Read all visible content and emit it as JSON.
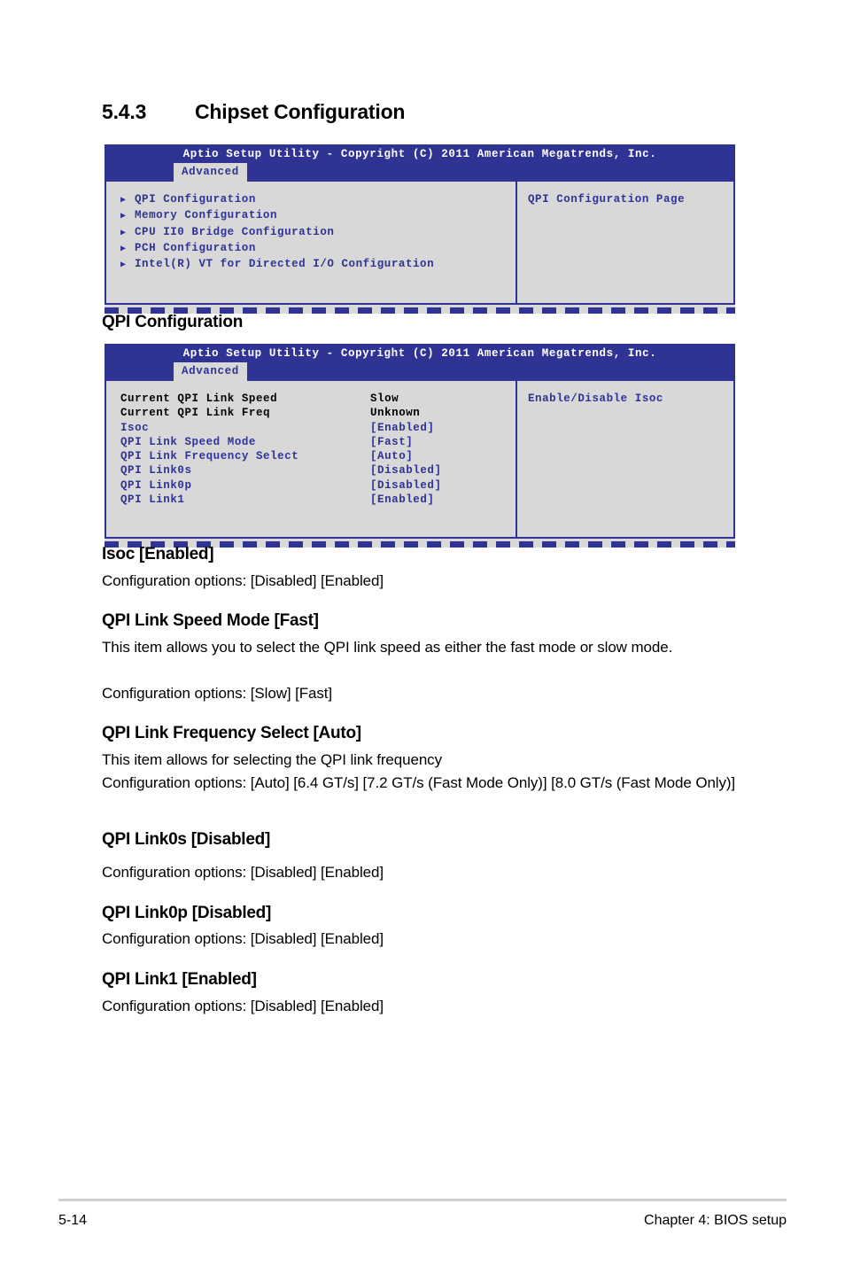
{
  "document": {
    "section_number": "5.4.3",
    "section_title": "Chipset Configuration",
    "subsection_title": "QPI Configuration"
  },
  "bios_screen_chipset": {
    "title": "Aptio Setup Utility - Copyright (C) 2011 American Megatrends, Inc.",
    "tab": "Advanced",
    "menu_items": [
      "QPI Configuration",
      "Memory Configuration",
      "CPU II0 Bridge Configuration",
      "PCH Configuration",
      "Intel(R) VT for Directed I/O Configuration"
    ],
    "help_text": "QPI Configuration Page",
    "arrow_glyph": "▶"
  },
  "bios_screen_qpi": {
    "title": "Aptio Setup Utility - Copyright (C) 2011 American Megatrends, Inc.",
    "tab": "Advanced",
    "help_text": "Enable/Disable Isoc",
    "rows": [
      {
        "label": "Current QPI Link Speed",
        "value": "Slow",
        "editable": false
      },
      {
        "label": "Current QPI Link Freq",
        "value": "Unknown",
        "editable": false
      },
      {
        "label": "Isoc",
        "value": "[Enabled]",
        "editable": true
      },
      {
        "label": "QPI Link Speed Mode",
        "value": "[Fast]",
        "editable": true
      },
      {
        "label": "QPI Link Frequency Select",
        "value": "[Auto]",
        "editable": true
      },
      {
        "label": "QPI Link0s",
        "value": "[Disabled]",
        "editable": true
      },
      {
        "label": "QPI Link0p",
        "value": "[Disabled]",
        "editable": true
      },
      {
        "label": "QPI Link1",
        "value": "[Enabled]",
        "editable": true
      }
    ]
  },
  "items": [
    {
      "title": "Isoc [Enabled]",
      "lines": [
        "Configuration options: [Disabled] [Enabled]"
      ]
    },
    {
      "title": "QPI Link Speed Mode [Fast]",
      "lines": [
        "This item allows you to select the QPI link speed as either the fast mode or slow mode.",
        "Configuration options: [Slow] [Fast]"
      ]
    },
    {
      "title": "QPI Link Frequency Select [Auto]",
      "lines": [
        "This item allows for selecting the QPI link frequency",
        "Configuration options: [Auto] [6.4 GT/s] [7.2 GT/s (Fast Mode Only)] [8.0 GT/s (Fast Mode Only)]"
      ]
    },
    {
      "title": "QPI Link0s [Disabled]",
      "lines": [
        "Configuration options: [Disabled] [Enabled]"
      ]
    },
    {
      "title": "QPI Link0p [Disabled]",
      "lines": [
        "Configuration options: [Disabled] [Enabled]"
      ]
    },
    {
      "title": "QPI Link1 [Enabled]",
      "lines": [
        "Configuration options: [Disabled] [Enabled]"
      ]
    }
  ],
  "footer": {
    "page_number": "5-14",
    "chapter": "Chapter 4: BIOS setup"
  },
  "colors": {
    "bios_blue": "#2f3494",
    "bios_panel": "#d8d8d8",
    "text_black": "#000000"
  }
}
